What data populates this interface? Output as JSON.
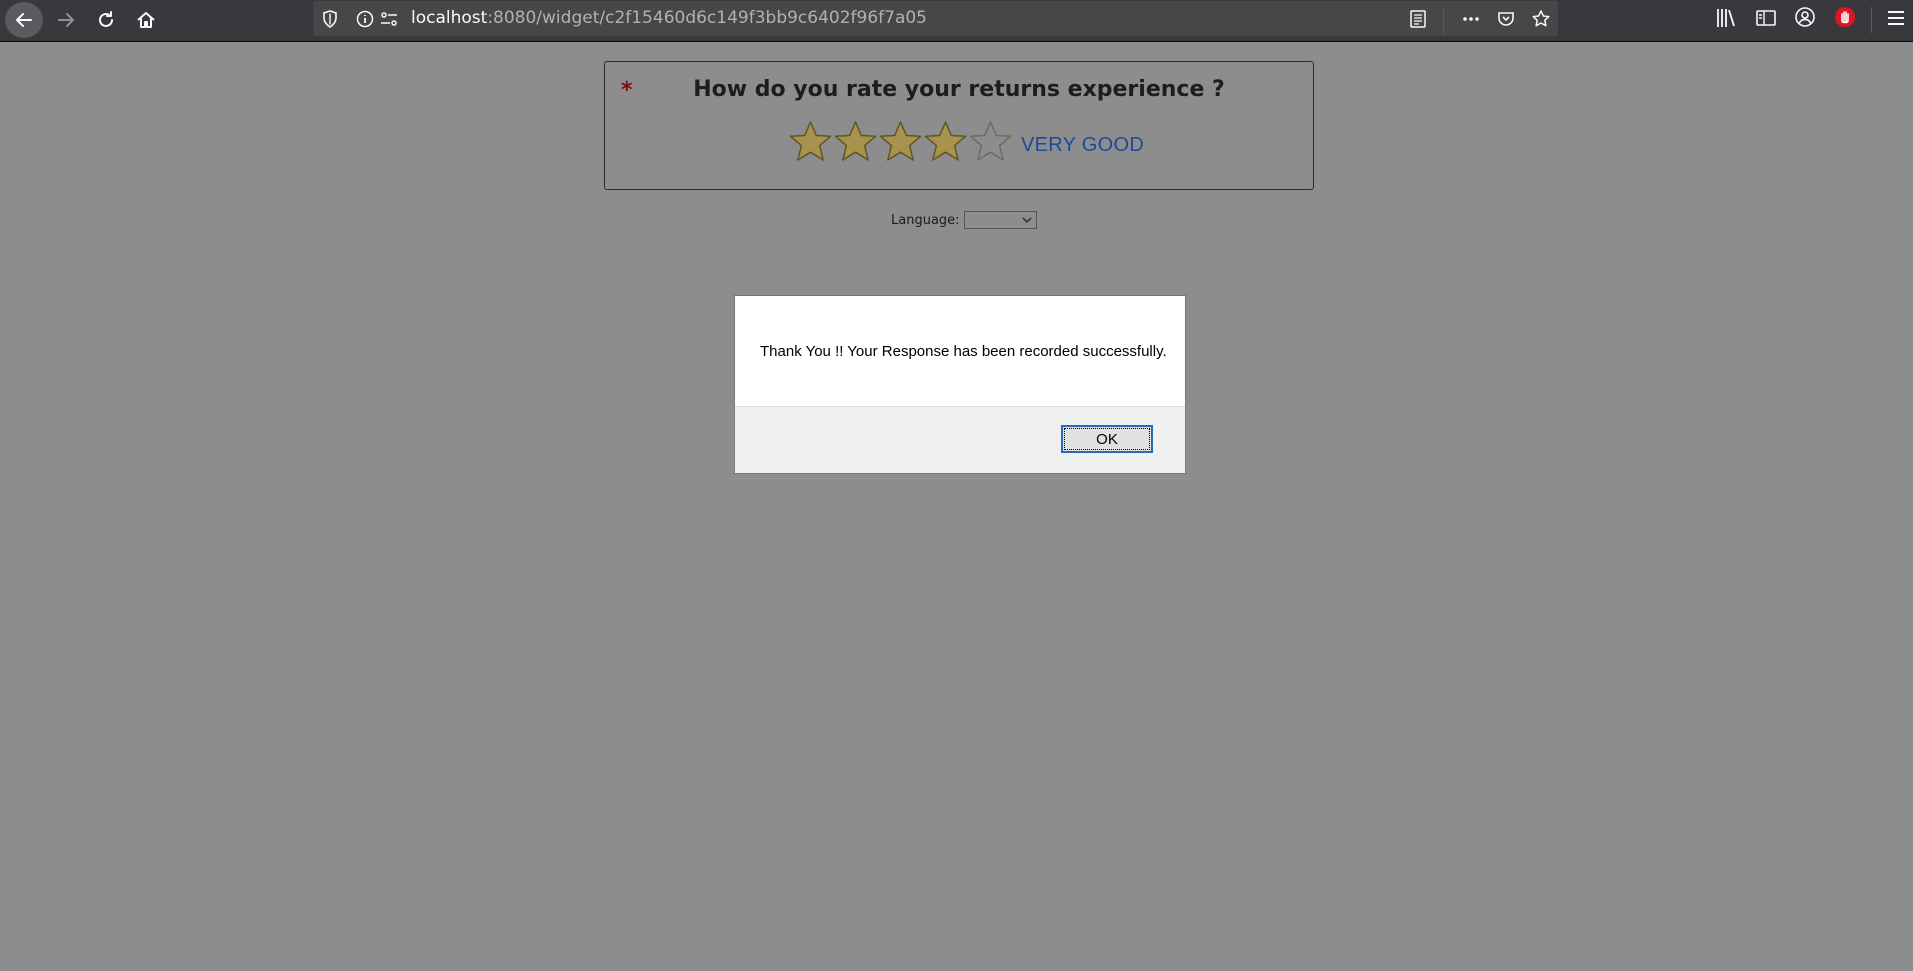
{
  "browser": {
    "url_host": "localhost",
    "url_rest": ":8080/widget/c2f15460d6c149f3bb9c6402f96f7a05",
    "icons": [
      "back-icon",
      "forward-icon",
      "reload-icon",
      "home-icon",
      "shield-icon",
      "info-icon",
      "permissions-icon",
      "reader-view-icon",
      "more-icon",
      "pocket-icon",
      "bookmark-star-icon",
      "library-icon",
      "sidebar-icon",
      "account-icon",
      "adblock-icon",
      "menu-icon"
    ]
  },
  "survey": {
    "required_mark": "*",
    "question": "How do you rate your returns experience ?",
    "rating": 4,
    "max_rating": 5,
    "rating_label": "VERY GOOD",
    "star_filled_color": "#a8934c",
    "star_empty_color": "#8d8d8d",
    "language_label": "Language:",
    "language_value": ""
  },
  "dialog": {
    "message": "Thank You !! Your Response has been recorded successfully.",
    "ok_label": "OK"
  }
}
